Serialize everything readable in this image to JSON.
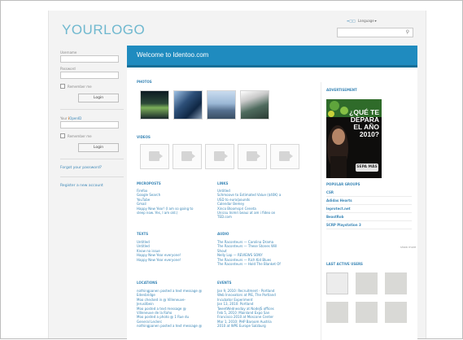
{
  "header": {
    "logo": "YOURLOGO",
    "language_label": "Language",
    "search_placeholder": ""
  },
  "login": {
    "username_label": "Username",
    "password_label": "Password",
    "remember_label": "Remember me",
    "login_button": "Login",
    "openid_label_pre": "Your",
    "openid_label_i": "i",
    "openid_label_post": "OpenID",
    "forgot_link": "Forgot your password?",
    "register_link": "Register a new account"
  },
  "main": {
    "banner": "Welcome to Identoo.com",
    "photos_title": "PHOTOS",
    "videos_title": "VIDEOS",
    "microposts_title": "MICROPOSTS",
    "microposts": [
      "Firefox",
      "Google Search",
      "YouTube",
      "Gmail",
      "Happy New Year! (I am so going to",
      "sleep now. Yes, I am old.)"
    ],
    "links_title": "LINKS",
    "links": [
      "Untitled",
      "Schmoove to Estimated Value ($40K) a",
      "USD to euro/pounds",
      "Calendar Bemey",
      "Xinco Bloomspri Ceneta",
      "Unicsu Inimri beaui at am i fideo on",
      "TED.com"
    ],
    "texts_title": "TEXTS",
    "texts": [
      "Untitled",
      "Untitled",
      "Know no issue",
      "Happy New Year everyone!",
      "Happy New Year everyone!"
    ],
    "audio_title": "AUDIO",
    "audio": [
      "The Raconteurs — Carolina Drama",
      "The Raconteurs — These Stones Will",
      "Shout",
      "Nelly Lop — REVIEWS SONY",
      "The Raconteurs — Rich Kid Blues",
      "The Raconteurs — Hold The Blanket Of"
    ],
    "locations_title": "LOCATIONS",
    "locations": [
      "nothingpanen posted a text message @",
      "Edenbridge",
      "Moo checked in @ Villeneuve-",
      "Jerusilbein",
      "Moo posted a text message @",
      "Villeneuve de la Raho",
      "Moo posted a photo @ 1 Rue du",
      "General Leclerc",
      "nothingpanen posted a text message @"
    ],
    "events_title": "EVENTS",
    "events": [
      "Jan 9, 2010: Recruitment - Portland",
      "Web Innovators at PIE, The Portland",
      "Incubator Experiment",
      "Jan 13, 2010: Portland",
      "TweetWednesday at NodeJS offices",
      "Feb 5, 2010: Mainland Expo San",
      "Francisco 2010 at Moscone Center",
      "Mar 1, 2010: PHP Baroom Austria",
      "2010 at WPE Europe Salzburg"
    ]
  },
  "sidebar": {
    "ad_title": "ADVERTISEMENT",
    "ad_text": "¿QUÉ TE DEPARA EL AÑO 2010?",
    "ad_button": "SEPA MÁS",
    "groups_title": "POPULAR GROUPS",
    "groups": [
      "CSR",
      "Adidas Hearts",
      "leprotect.net",
      "BeastRob",
      "SCRP Playstation 3"
    ],
    "show_more": "show more",
    "users_title": "LAST ACTIVE USERS"
  },
  "colors": {
    "accent": "#1f8bbf",
    "link": "#3a86b6",
    "logo": "#6fb8cf"
  }
}
